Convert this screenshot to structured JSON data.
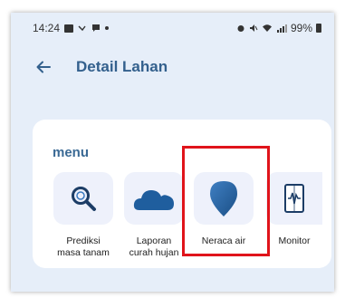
{
  "status_bar": {
    "time": "14:24",
    "battery": "99%"
  },
  "header": {
    "title": "Detail Lahan"
  },
  "menu": {
    "heading": "menu",
    "items": [
      {
        "label": "Prediksi\nmasa tanam",
        "icon": "magnifier-icon"
      },
      {
        "label": "Laporan\ncurah hujan",
        "icon": "cloud-icon"
      },
      {
        "label": "Neraca air",
        "icon": "water-drop-icon"
      },
      {
        "label": "Monitor",
        "icon": "sensor-monitor-icon"
      }
    ],
    "highlighted_item": "Neraca air"
  },
  "colors": {
    "background": "#e6eef9",
    "card": "#ffffff",
    "title": "#33608d",
    "icon_blue": "#1f5e9e",
    "highlight": "#e0141b"
  }
}
